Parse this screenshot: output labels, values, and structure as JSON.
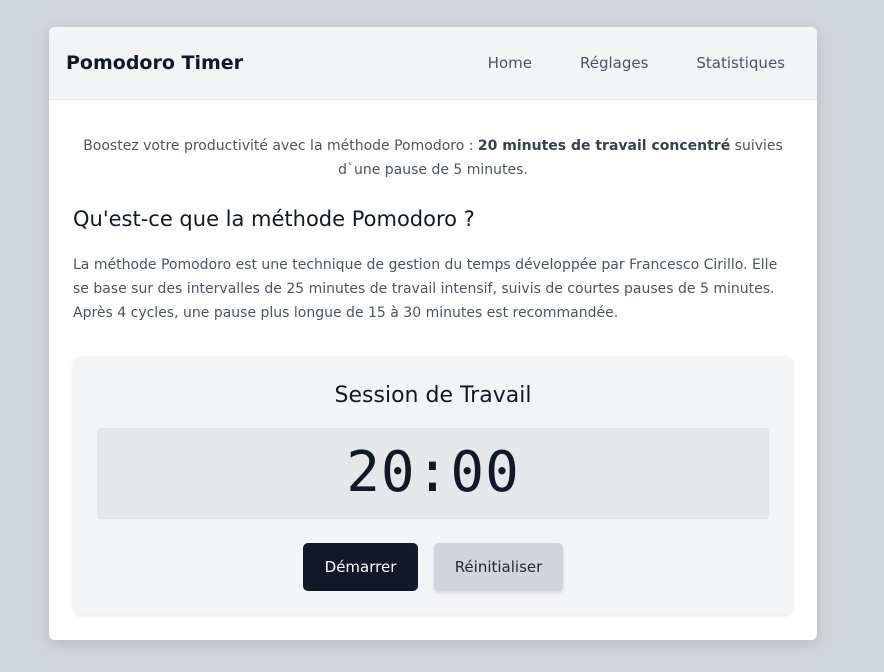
{
  "app": {
    "title": "Pomodoro Timer"
  },
  "nav": {
    "items": [
      "Home",
      "Réglages",
      "Statistiques"
    ]
  },
  "intro": {
    "before": "Boostez votre productivité avec la méthode Pomodoro : ",
    "highlight": "20 minutes de travail concentré",
    "after": " suivies d`une pause de 5 minutes."
  },
  "section": {
    "title": "Qu'est-ce que la méthode Pomodoro ?",
    "description": "La méthode Pomodoro est une technique de gestion du temps développée par Francesco Cirillo. Elle se base sur des intervalles de 25 minutes de travail intensif, suivis de courtes pauses de 5 minutes. Après 4 cycles, une pause plus longue de 15 à 30 minutes est recommandée."
  },
  "timer": {
    "session_label": "Session de Travail",
    "time": "20:00",
    "start_label": "Démarrer",
    "reset_label": "Réinitialiser"
  },
  "colors": {
    "background": "#d1d5dc",
    "panel": "#f3f4f6",
    "primary_button": "#111827",
    "secondary_button": "#d1d5db"
  }
}
